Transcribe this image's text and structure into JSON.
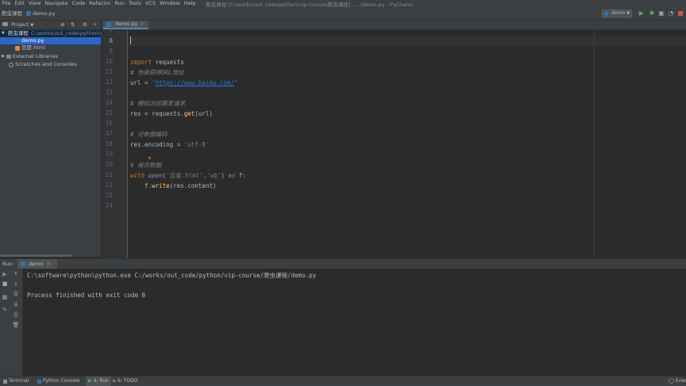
{
  "menu": {
    "items": [
      "File",
      "Edit",
      "View",
      "Navigate",
      "Code",
      "Refactor",
      "Run",
      "Tools",
      "VCS",
      "Window",
      "Help"
    ],
    "window_title": "爬虫课程 [C:\\works\\out_code\\python\\vip-course\\爬虫课程] - ...\\demo.py - PyCharm"
  },
  "navbar": {
    "project_crumb": "爬虫课程",
    "file_crumb": "demo.py",
    "run_config": "demo"
  },
  "project_panel": {
    "header": "Project",
    "root_name": "爬虫课程",
    "root_path": "C:\\works\\out_code\\python\\vi",
    "files": [
      "demo.py",
      "百度.html"
    ],
    "external_libraries": "External Libraries",
    "scratches": "Scratches and Consoles"
  },
  "editor": {
    "tab_label": "demo.py",
    "line_numbers": [
      "7",
      "8",
      "9",
      "10",
      "11",
      "12",
      "13",
      "14",
      "15",
      "16",
      "17",
      "18",
      "19",
      "20",
      "21",
      "22",
      "23",
      "24"
    ],
    "current_line": "8",
    "code": {
      "l10_kw": "import",
      "l10_mod": " requests",
      "l11_comment": "# 伪装获得URL地址",
      "l12_a": "url = ",
      "l12_q1": "'",
      "l12_url": "https://www.baidu.com/",
      "l12_q2": "'",
      "l14_comment": "# 模拟浏览器发请求",
      "l15_a": "res = requests.",
      "l15_fn": "get",
      "l15_b": "(url)",
      "l17_comment": "# 对数据编码",
      "l18_a": "res.encoding = ",
      "l18_str": "'utf-8'",
      "l20_comment": "# 保存数据",
      "l21_with": "with",
      "l21_open": " open",
      "l21_p1": "(",
      "l21_s1": "'百度.html'",
      "l21_comma": ",",
      "l21_s2": "'wb'",
      "l21_p2": ") ",
      "l21_as": "as",
      "l21_f": " f:",
      "l22_a": "    f.",
      "l22_fn": "write",
      "l22_b": "(res.content)"
    }
  },
  "run_panel": {
    "label": "Run:",
    "tab": "demo",
    "output_line1": "C:\\software\\python\\python.exe C:/works/out_code/python/vip-course/爬虫课程/demo.py",
    "output_line2": "Process finished with exit code 0"
  },
  "statusbar": {
    "terminal": "Terminal",
    "python_console": "Python Console",
    "run": "4: Run",
    "todo": "6: TODO",
    "event_log": "Even"
  }
}
